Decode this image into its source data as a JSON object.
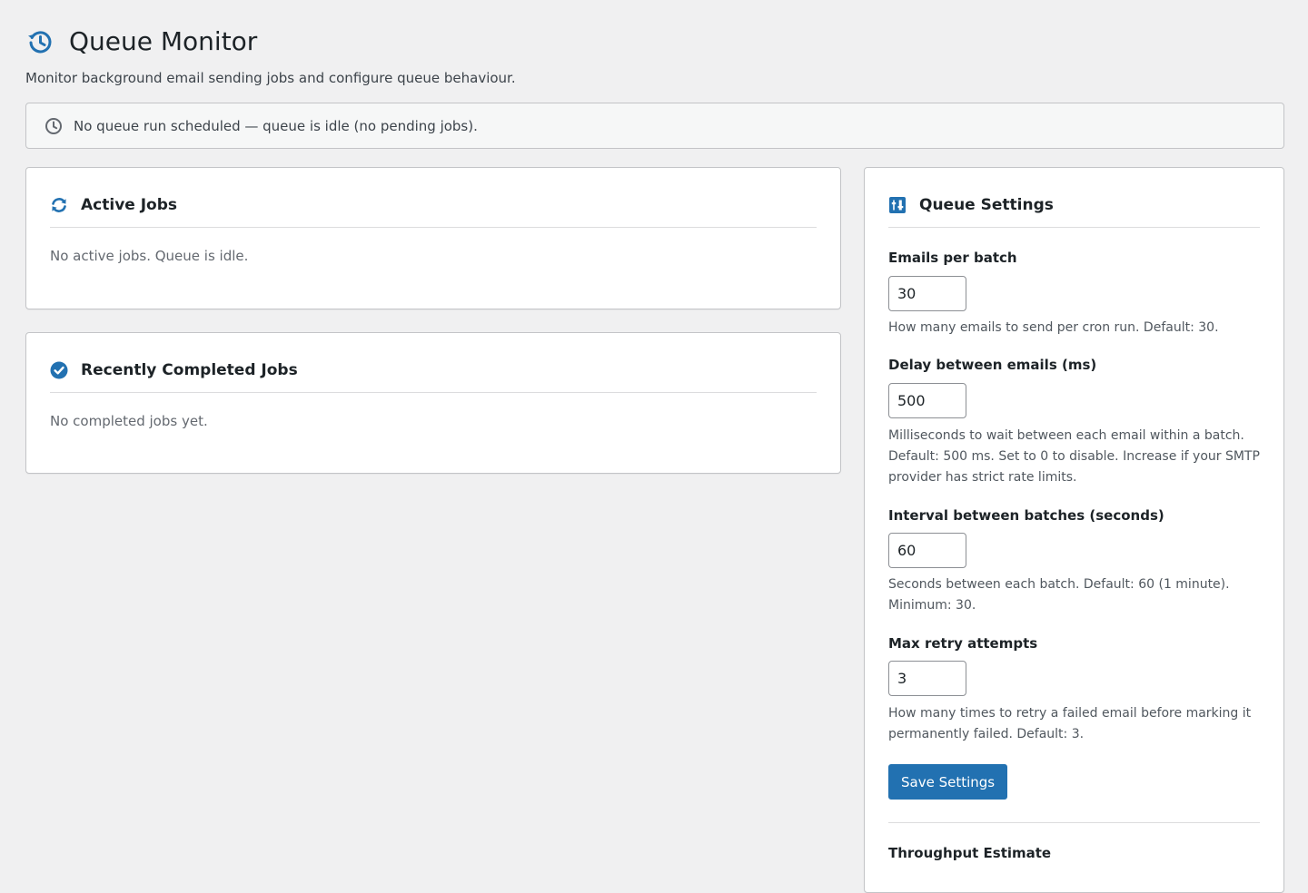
{
  "header": {
    "title": "Queue Monitor",
    "description": "Monitor background email sending jobs and configure queue behaviour.",
    "icon": "history-icon"
  },
  "notice": {
    "text": "No queue run scheduled — queue is idle (no pending jobs).",
    "icon": "clock-icon"
  },
  "active_jobs": {
    "title": "Active Jobs",
    "empty_text": "No active jobs. Queue is idle.",
    "icon": "refresh-icon"
  },
  "completed_jobs": {
    "title": "Recently Completed Jobs",
    "empty_text": "No completed jobs yet.",
    "icon": "check-circle-icon"
  },
  "settings": {
    "title": "Queue Settings",
    "icon": "sliders-icon",
    "fields": [
      {
        "label": "Emails per batch",
        "value": "30",
        "help": "How many emails to send per cron run. Default: 30."
      },
      {
        "label": "Delay between emails (ms)",
        "value": "500",
        "help": "Milliseconds to wait between each email within a batch. Default: 500 ms. Set to 0 to disable. Increase if your SMTP provider has strict rate limits."
      },
      {
        "label": "Interval between batches (seconds)",
        "value": "60",
        "help": "Seconds between each batch. Default: 60 (1 minute). Minimum: 30."
      },
      {
        "label": "Max retry attempts",
        "value": "3",
        "help": "How many times to retry a failed email before marking it permanently failed. Default: 3."
      }
    ],
    "save_label": "Save Settings",
    "throughput_title": "Throughput Estimate"
  },
  "colors": {
    "accent": "#2271b1",
    "background": "#f0f0f1",
    "card": "#ffffff",
    "border": "#c3c4c7",
    "muted_text": "#646970"
  }
}
